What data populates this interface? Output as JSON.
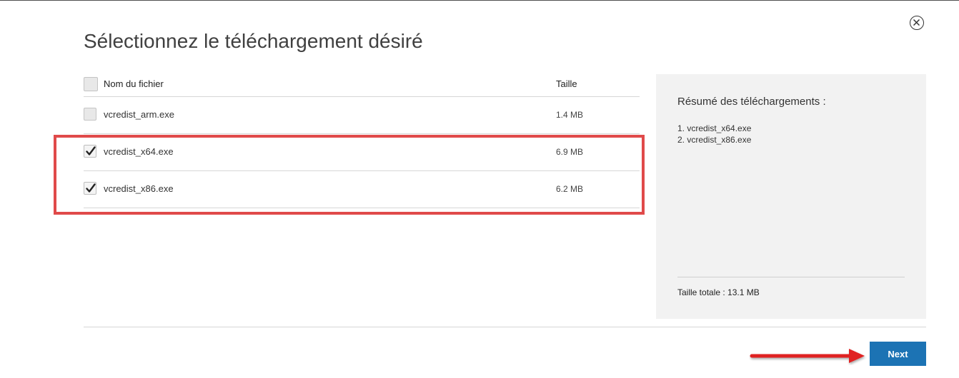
{
  "dialog": {
    "title": "Sélectionnez le téléchargement désiré",
    "close_icon": "close-circle-icon"
  },
  "table": {
    "headers": {
      "name": "Nom du fichier",
      "size": "Taille"
    },
    "select_all_checked": false,
    "rows": [
      {
        "name": "vcredist_arm.exe",
        "size": "1.4 MB",
        "checked": false
      },
      {
        "name": "vcredist_x64.exe",
        "size": "6.9 MB",
        "checked": true
      },
      {
        "name": "vcredist_x86.exe",
        "size": "6.2 MB",
        "checked": true
      }
    ]
  },
  "summary": {
    "title": "Résumé des téléchargements :",
    "items": [
      "1. vcredist_x64.exe",
      "2. vcredist_x86.exe"
    ],
    "total": "Taille totale : 13.1 MB"
  },
  "footer": {
    "next_label": "Next"
  },
  "annotations": {
    "highlight_color": "#e04a4a",
    "arrow_color": "#e02020",
    "arrow_icon": "red-arrow-right-icon"
  },
  "colors": {
    "primary_button": "#1c73b4",
    "summary_background": "#f2f2f2"
  }
}
